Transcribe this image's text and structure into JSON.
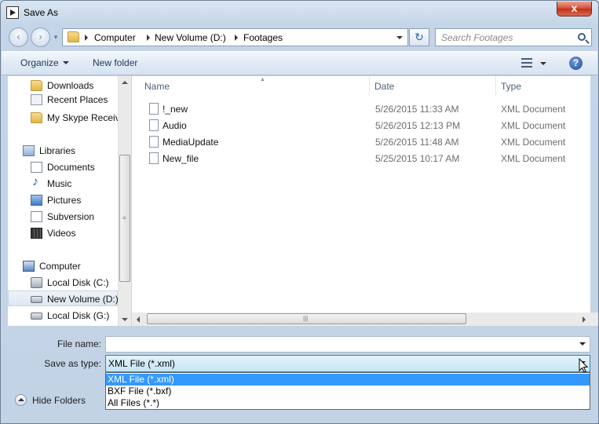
{
  "window": {
    "title": "Save As",
    "close_label": "x"
  },
  "navigation": {
    "back_label": "‹",
    "forward_label": "›",
    "breadcrumbs": [
      "Computer",
      "New Volume (D:)",
      "Footages"
    ],
    "refresh_label": "↻",
    "search_placeholder": "Search Footages"
  },
  "toolbar": {
    "organize_label": "Organize",
    "new_folder_label": "New folder",
    "help_label": "?"
  },
  "sidebar": {
    "items": [
      {
        "label": "Downloads",
        "icon": "folder-icon"
      },
      {
        "label": "Recent Places",
        "icon": "recent-places-icon"
      },
      {
        "label": "My Skype Received Files",
        "icon": "folder-icon"
      },
      {
        "label": "Libraries",
        "icon": "libraries-icon"
      },
      {
        "label": "Documents",
        "icon": "documents-icon"
      },
      {
        "label": "Music",
        "icon": "music-icon"
      },
      {
        "label": "Pictures",
        "icon": "pictures-icon"
      },
      {
        "label": "Subversion",
        "icon": "documents-icon"
      },
      {
        "label": "Videos",
        "icon": "videos-icon"
      },
      {
        "label": "Computer",
        "icon": "computer-icon"
      },
      {
        "label": "Local Disk (C:)",
        "icon": "drive-icon"
      },
      {
        "label": "New Volume (D:)",
        "icon": "drive-icon",
        "selected": true
      },
      {
        "label": "Local Disk (G:)",
        "icon": "drive-icon"
      }
    ]
  },
  "file_list": {
    "columns": [
      "Name",
      "Date",
      "Type"
    ],
    "rows": [
      {
        "name": "!_new",
        "date": "5/26/2015 11:33 AM",
        "type": "XML Document"
      },
      {
        "name": "Audio",
        "date": "5/26/2015 12:13 PM",
        "type": "XML Document"
      },
      {
        "name": "MediaUpdate",
        "date": "5/26/2015 11:48 AM",
        "type": "XML Document"
      },
      {
        "name": "New_file",
        "date": "5/25/2015 10:17 AM",
        "type": "XML Document"
      }
    ]
  },
  "form": {
    "file_name_label": "File name:",
    "file_name_value": "",
    "save_type_label": "Save as type:",
    "save_type_value": "XML File (*.xml)",
    "save_type_options": [
      "XML File (*.xml)",
      "BXF File (*.bxf)",
      "All Files (*.*)"
    ]
  },
  "footer": {
    "hide_folders_label": "Hide Folders"
  },
  "colors": {
    "selection": "#3399ff",
    "select_border": "#3c7fb1",
    "close_button": "#c2321c"
  }
}
